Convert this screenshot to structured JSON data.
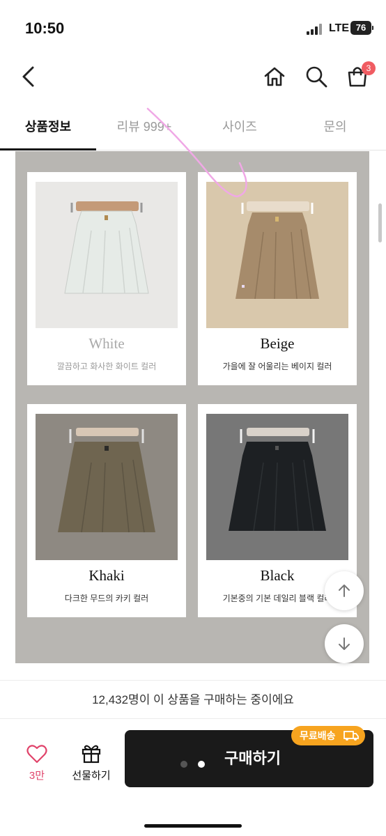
{
  "status_bar": {
    "time": "10:50",
    "network": "LTE",
    "battery": "76"
  },
  "nav": {
    "cart_count": "3",
    "icons": [
      "back-icon",
      "home-icon",
      "search-icon",
      "cart-icon"
    ]
  },
  "tabs": [
    {
      "label": "상품정보",
      "active": true
    },
    {
      "label": "리뷰 999+",
      "active": false
    },
    {
      "label": "사이즈",
      "active": false
    },
    {
      "label": "문의",
      "active": false
    }
  ],
  "colors": {
    "panel_bg": "#b8b6b2",
    "like_pink": "#e0436a",
    "badge_orange": "#f7a41f",
    "buy_button": "#1a1a1a"
  },
  "products": [
    {
      "name": "White",
      "desc": "깔끔하고 화사한 화이트 컬러",
      "photo_bg": "#e9e8e6",
      "skirt_color": "#e6ebe7"
    },
    {
      "name": "Beige",
      "desc": "가을에 잘 어울리는 베이지 컬러",
      "photo_bg": "#d9c8ac",
      "skirt_color": "#a68b6b"
    },
    {
      "name": "Khaki",
      "desc": "다크한 무드의 카키 컬러",
      "photo_bg": "#8e8982",
      "skirt_color": "#6f6550"
    },
    {
      "name": "Black",
      "desc": "기본중의 기본 데일리 블랙 컬러",
      "photo_bg": "#777777",
      "skirt_color": "#1d2023"
    }
  ],
  "purchase_info": "12,432명이 이 상품을 구매하는 중이에요",
  "bottom": {
    "like_count": "3만",
    "gift_label": "선물하기",
    "buy_label": "구매하기",
    "shipping_badge": "무료배송"
  }
}
